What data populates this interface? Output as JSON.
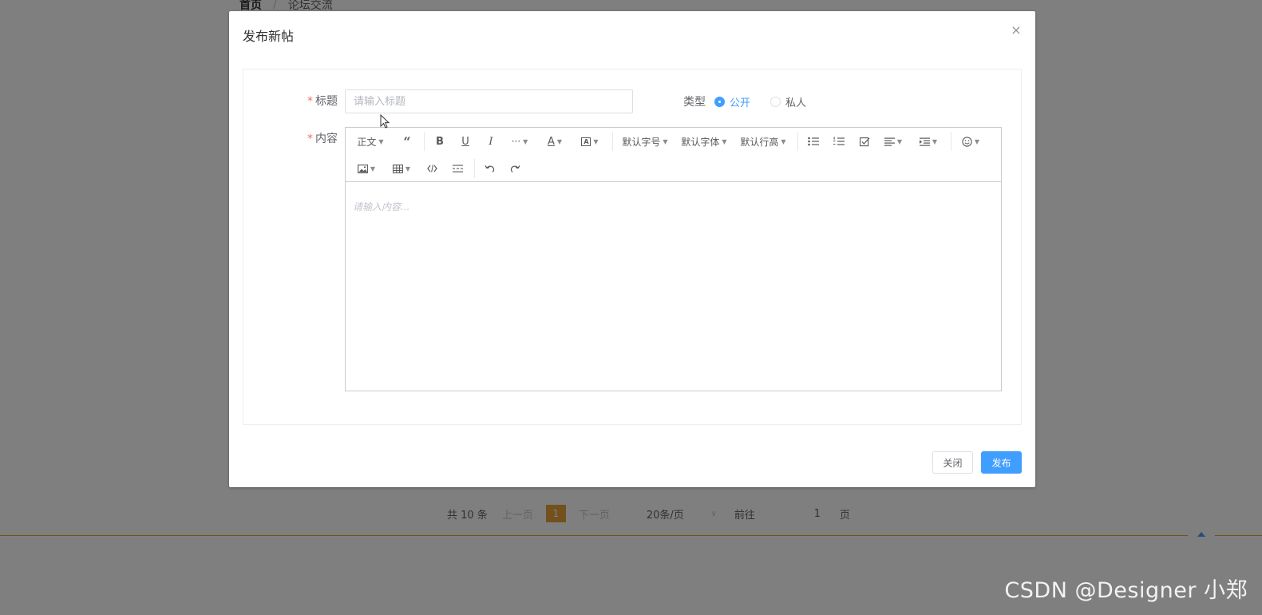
{
  "background": {
    "breadcrumb": {
      "home": "首页",
      "separator": "/",
      "current": "论坛交流"
    },
    "pagination": {
      "total": "共 10 条",
      "prev": "上一页",
      "current_page": "1",
      "next": "下一页",
      "page_size": "20条/页",
      "goto_label": "前往",
      "goto_value": "1",
      "goto_unit": "页"
    }
  },
  "watermark": "CSDN @Designer 小郑",
  "dialog": {
    "title": "发布新帖",
    "close_icon": "×",
    "form": {
      "title_label": "标题",
      "title_placeholder": "请输入标题",
      "title_value": "",
      "type_label": "类型",
      "type_options": [
        "公开",
        "私人"
      ],
      "type_selected": "公开",
      "content_label": "内容",
      "required_mark": "*"
    },
    "editor": {
      "toolbar_row1": {
        "paragraph": "正文",
        "font_size": "默认字号",
        "font_family": "默认字体",
        "line_height": "默认行高",
        "more": "···",
        "color": "A",
        "bg_color": "A"
      },
      "placeholder": "请输入内容..."
    },
    "footer": {
      "close_label": "关闭",
      "publish_label": "发布"
    }
  },
  "colors": {
    "primary": "#409eff",
    "required": "#f56c6c",
    "page_accent": "#e6a23c"
  }
}
